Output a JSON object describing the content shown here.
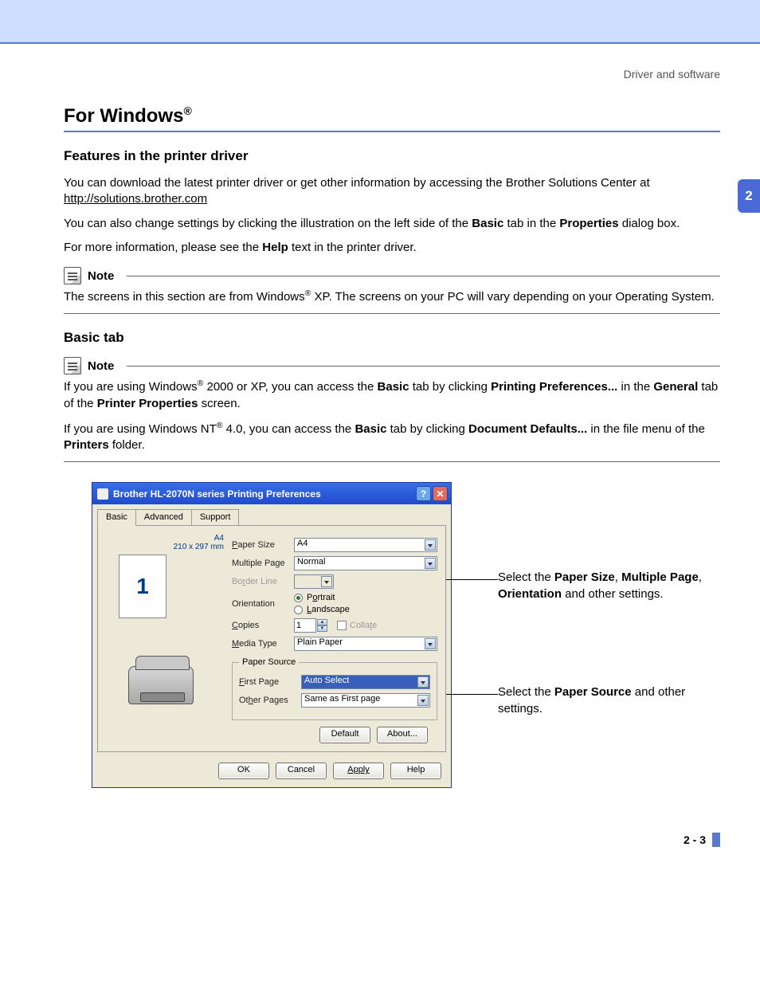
{
  "header": {
    "breadcrumb": "Driver and software"
  },
  "chapter_tab": "2",
  "title": {
    "main": "For Windows",
    "sup": "®"
  },
  "section1": {
    "heading": "Features in the printer driver",
    "para1_a": "You can download the latest printer driver or get other information by accessing the Brother Solutions Center at ",
    "para1_link": "http://solutions.brother.com",
    "para2_a": "You can also change settings by clicking the illustration on the left side of the ",
    "para2_b": "Basic",
    "para2_c": " tab in the ",
    "para2_d": "Properties",
    "para2_e": " dialog box.",
    "para3_a": "For more information, please see the ",
    "para3_b": "Help",
    "para3_c": " text in the printer driver."
  },
  "note1": {
    "label": "Note",
    "body_a": "The screens in this section are from Windows",
    "body_sup": "®",
    "body_b": " XP. The screens on your PC will vary depending on your Operating System."
  },
  "section2": {
    "heading": "Basic tab"
  },
  "note2": {
    "label": "Note",
    "line1_a": "If you are using Windows",
    "line1_sup": "®",
    "line1_b": " 2000 or XP, you can access the ",
    "line1_c": "Basic",
    "line1_d": " tab by clicking ",
    "line1_e": "Printing Preferences...",
    "line1_f": " in the ",
    "line1_g": "General",
    "line1_h": " tab of the ",
    "line1_i": "Printer Properties",
    "line1_j": " screen.",
    "line2_a": "If you are using Windows NT",
    "line2_sup": "®",
    "line2_b": " 4.0, you can access the ",
    "line2_c": "Basic",
    "line2_d": " tab by clicking ",
    "line2_e": "Document Defaults...",
    "line2_f": " in the file menu of the ",
    "line2_g": "Printers",
    "line2_h": " folder."
  },
  "dialog": {
    "title": "Brother HL-2070N series Printing Preferences",
    "tabs": {
      "basic": "Basic",
      "advanced": "Advanced",
      "support": "Support"
    },
    "preview": {
      "size_label": "A4",
      "dims": "210 x 297 mm",
      "page_num": "1"
    },
    "fields": {
      "paper_size": {
        "label": "Paper Size",
        "value": "A4"
      },
      "multiple_page": {
        "label": "Multiple Page",
        "value": "Normal"
      },
      "border_line": {
        "label": "Border Line",
        "value": ""
      },
      "orientation": {
        "label": "Orientation",
        "portrait": "Portrait",
        "landscape": "Landscape"
      },
      "copies": {
        "label": "Copies",
        "value": "1",
        "collate": "Collate"
      },
      "media_type": {
        "label": "Media Type",
        "value": "Plain Paper"
      }
    },
    "paper_source": {
      "legend": "Paper Source",
      "first_page": {
        "label": "First Page",
        "value": "Auto Select"
      },
      "other_pages": {
        "label": "Other Pages",
        "value": "Same as First page"
      }
    },
    "buttons": {
      "default": "Default",
      "about": "About...",
      "ok": "OK",
      "cancel": "Cancel",
      "apply": "Apply",
      "help": "Help"
    }
  },
  "callouts": {
    "c1_a": "Select the ",
    "c1_b": "Paper Size",
    "c1_c": ", ",
    "c1_d": "Multiple Page",
    "c1_e": ", ",
    "c1_f": "Orientation",
    "c1_g": " and other settings.",
    "c2_a": "Select the ",
    "c2_b": "Paper Source",
    "c2_c": " and other settings."
  },
  "page_number": "2 - 3"
}
